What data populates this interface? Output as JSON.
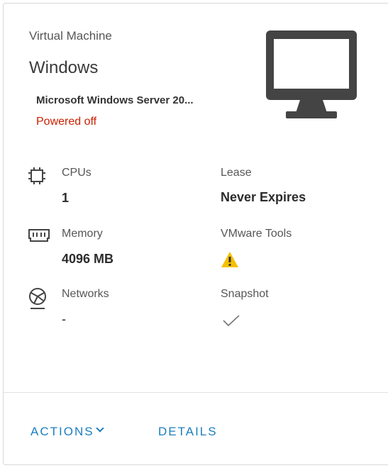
{
  "card": {
    "type_label": "Virtual Machine",
    "os_label": "Windows",
    "os_full": "Microsoft Windows Server 20...",
    "power_state": "Powered off",
    "icon": "monitor-icon"
  },
  "properties": {
    "cpus": {
      "label": "CPUs",
      "value": "1",
      "icon": "cpu-chip-icon"
    },
    "memory": {
      "label": "Memory",
      "value": "4096 MB",
      "icon": "memory-icon"
    },
    "networks": {
      "label": "Networks",
      "value": "-",
      "icon": "network-icon"
    },
    "lease": {
      "label": "Lease",
      "value": "Never Expires"
    },
    "tools": {
      "label": "VMware Tools",
      "status_icon": "warning-icon"
    },
    "snapshot": {
      "label": "Snapshot",
      "status_icon": "checkmark-icon"
    }
  },
  "footer": {
    "actions_label": "ACTIONS",
    "details_label": "DETAILS"
  },
  "colors": {
    "link": "#1b7ec0",
    "powered_off": "#c92100",
    "warning": "#f5c000",
    "monitor": "#444444"
  }
}
